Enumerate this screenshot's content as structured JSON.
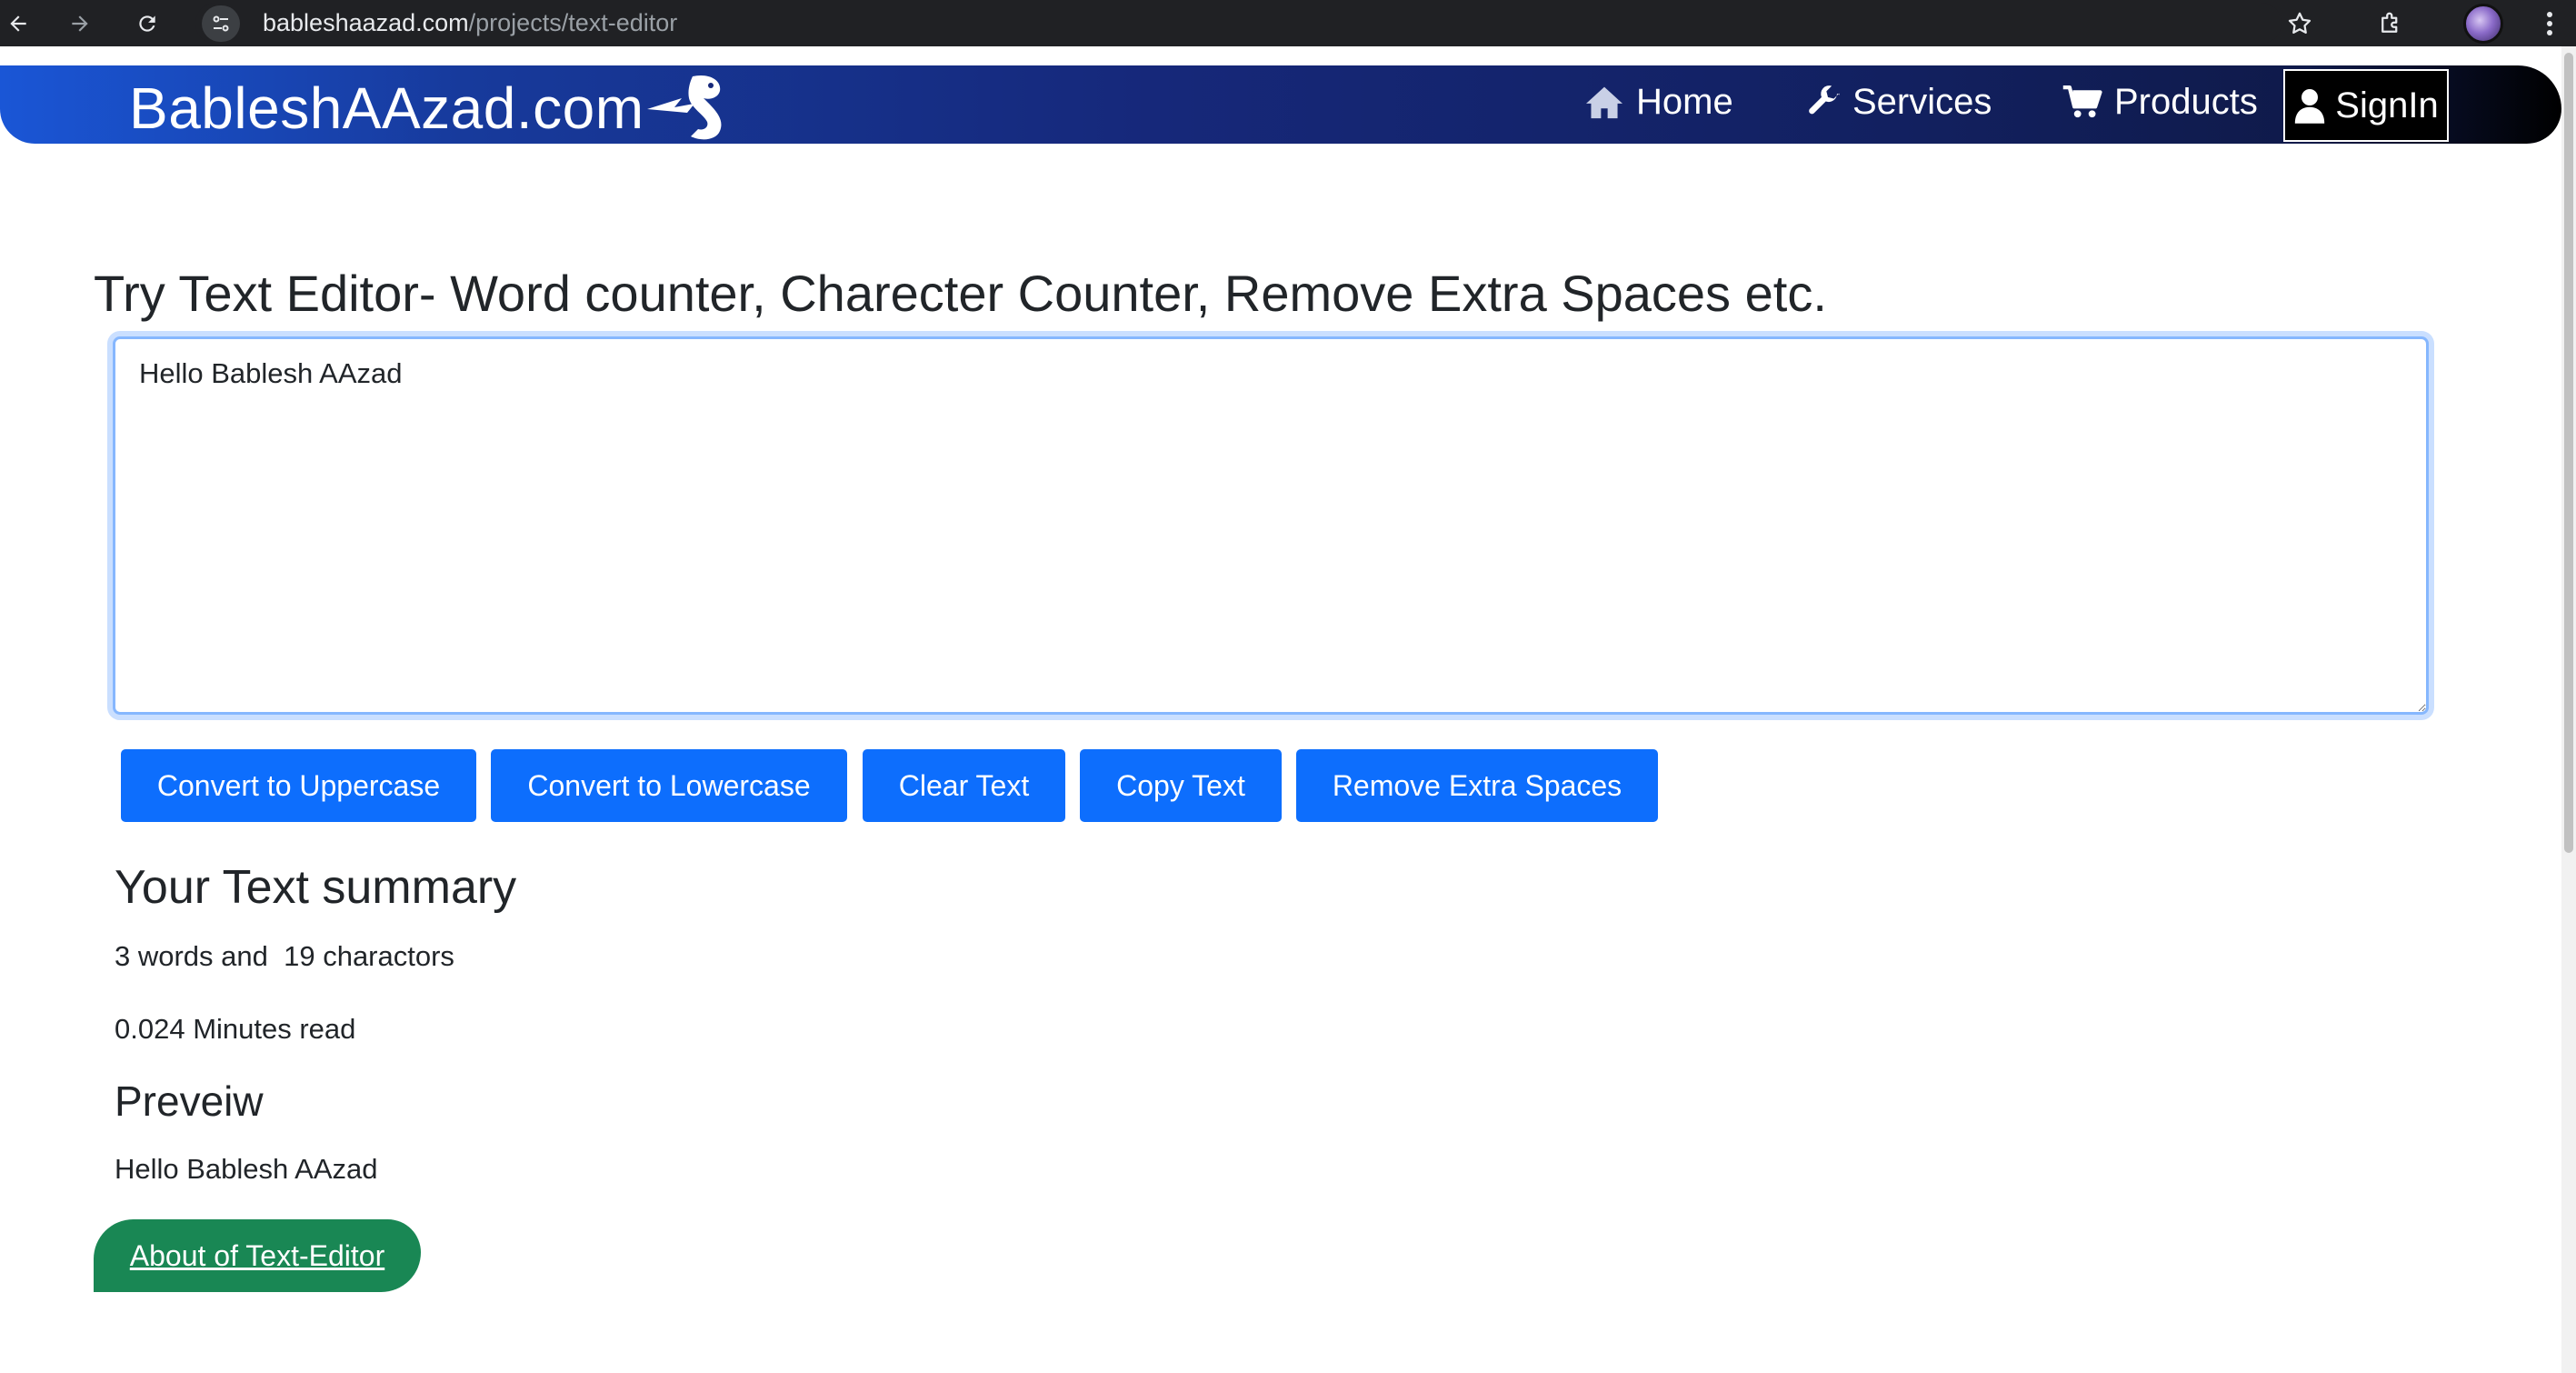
{
  "browser": {
    "url_host": "bableshaazad.com",
    "url_path": "/projects/text-editor"
  },
  "navbar": {
    "brand": "BableshAAzad.com",
    "items": [
      {
        "label": "Home",
        "icon": "home-icon"
      },
      {
        "label": "Services",
        "icon": "wrench-icon"
      },
      {
        "label": "Products",
        "icon": "cart-icon"
      }
    ],
    "signin": "SignIn"
  },
  "main": {
    "title": "Try Text Editor- Word counter, Charecter Counter, Remove Extra Spaces etc.",
    "editor_value": "Hello Bablesh AAzad",
    "buttons": {
      "uppercase": "Convert to Uppercase",
      "lowercase": "Convert to Lowercase",
      "clear": "Clear Text",
      "copy": "Copy Text",
      "remove_spaces": "Remove Extra Spaces"
    },
    "summary": {
      "title": "Your Text summary",
      "counts": "3 words and  19 charactors",
      "read_time": "0.024 Minutes read"
    },
    "preview": {
      "title": "Preveiw",
      "text": "Hello Bablesh AAzad"
    },
    "about_link": "About of Text-Editor"
  },
  "colors": {
    "primary_button": "#0d6efd",
    "about_button": "#198754",
    "navbar_start": "#1a56d6",
    "navbar_end": "#000000"
  }
}
